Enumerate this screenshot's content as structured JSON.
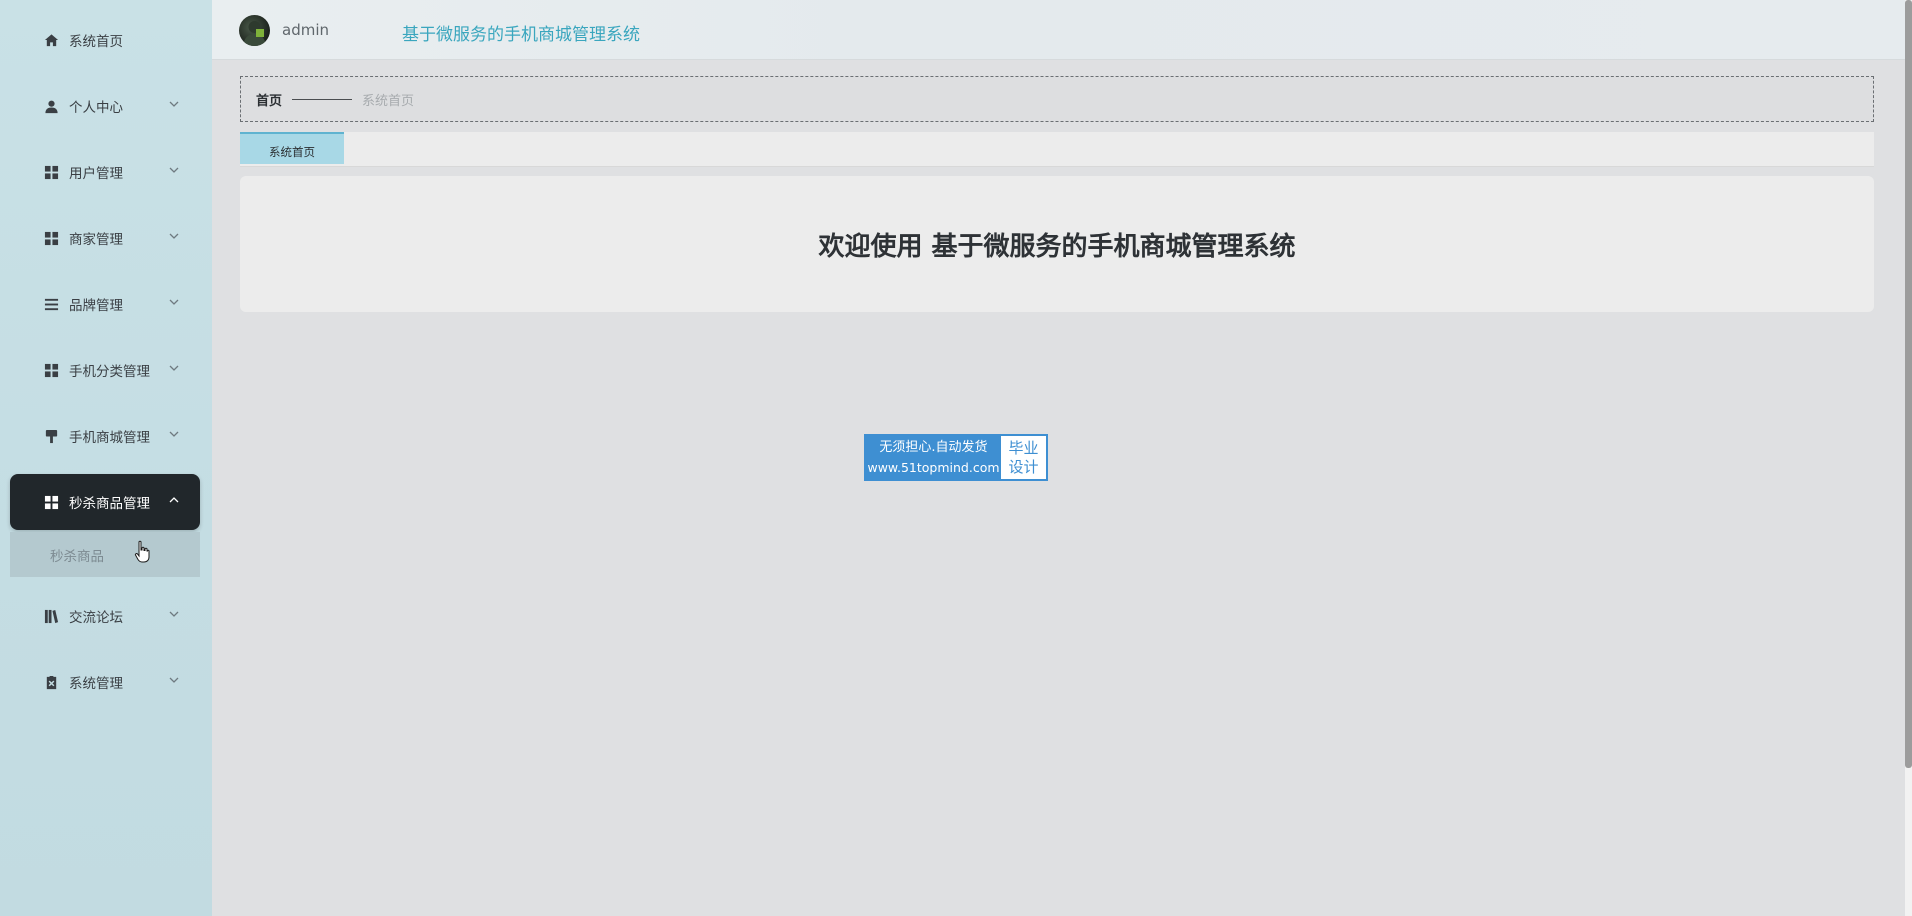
{
  "sidebar": {
    "items": [
      {
        "label": "系统首页",
        "icon": "home-icon"
      },
      {
        "label": "个人中心",
        "icon": "user-icon"
      },
      {
        "label": "用户管理",
        "icon": "grid-icon"
      },
      {
        "label": "商家管理",
        "icon": "grid-icon"
      },
      {
        "label": "品牌管理",
        "icon": "list-icon"
      },
      {
        "label": "手机分类管理",
        "icon": "grid-icon"
      },
      {
        "label": "手机商城管理",
        "icon": "brush-icon"
      },
      {
        "label": "秒杀商品管理",
        "icon": "grid-icon"
      },
      {
        "label": "交流论坛",
        "icon": "book-icon"
      },
      {
        "label": "系统管理",
        "icon": "clipboard-icon"
      }
    ],
    "active_index": 7,
    "submenu": {
      "label": "秒杀商品"
    }
  },
  "header": {
    "username": "admin",
    "title": "基于微服务的手机商城管理系统"
  },
  "breadcrumb": {
    "home": "首页",
    "current": "系统首页"
  },
  "tabs": [
    {
      "label": "系统首页"
    }
  ],
  "main": {
    "welcome": "欢迎使用 基于微服务的手机商城管理系统"
  },
  "watermark": {
    "line1": "无须担心.自动发货",
    "line2": "www.51topmind.com",
    "right1": "毕业",
    "right2": "设计"
  },
  "colors": {
    "accent": "#3aa6be",
    "sidebar_bg": "#c4dde3",
    "active_item_bg": "#21272b",
    "tab_bg": "#a8d8e6",
    "watermark_blue": "#3e8fd2"
  }
}
